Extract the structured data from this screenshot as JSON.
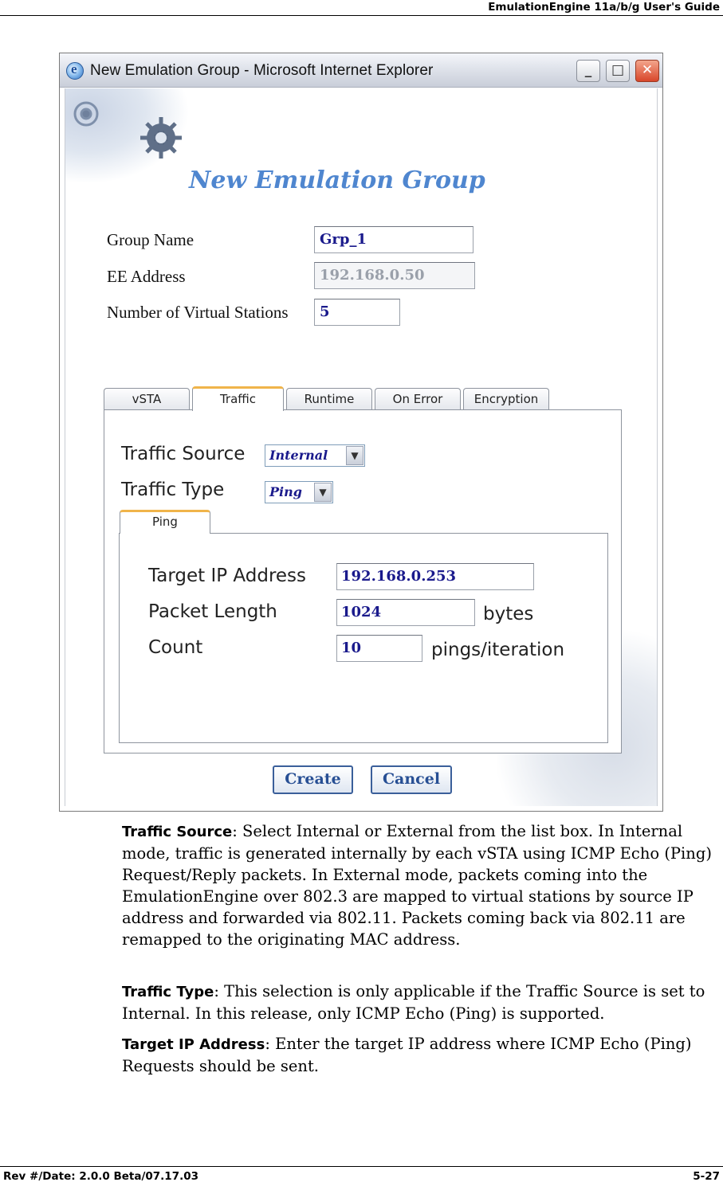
{
  "page_header": {
    "title": "EmulationEngine 11a/b/g User's Guide"
  },
  "page_footer": {
    "left": "Rev #/Date: 2.0.0 Beta/07.17.03",
    "right": "5-27"
  },
  "window": {
    "title": "New Emulation Group - Microsoft Internet Explorer",
    "buttons": {
      "minimize": "_",
      "maximize": "□",
      "close": "✕"
    }
  },
  "form": {
    "heading": "New Emulation Group",
    "group_name": {
      "label": "Group Name",
      "value": "Grp_1"
    },
    "ee_address": {
      "label": "EE Address",
      "value": "192.168.0.50"
    },
    "num_stations": {
      "label": "Number of Virtual Stations",
      "value": "5"
    }
  },
  "tabs": [
    {
      "label": "vSTA",
      "active": false
    },
    {
      "label": "Traffic",
      "active": true
    },
    {
      "label": "Runtime",
      "active": false
    },
    {
      "label": "On Error",
      "active": false
    },
    {
      "label": "Encryption",
      "active": false
    }
  ],
  "traffic": {
    "source": {
      "label": "Traffic Source",
      "value": "Internal"
    },
    "type": {
      "label": "Traffic Type",
      "value": "Ping"
    },
    "subtab": "Ping",
    "ping": {
      "target_ip": {
        "label": "Target IP Address",
        "value": "192.168.0.253"
      },
      "packet_length": {
        "label": "Packet Length",
        "value": "1024",
        "unit": "bytes"
      },
      "count": {
        "label": "Count",
        "value": "10",
        "unit": "pings/iteration"
      }
    }
  },
  "actions": {
    "create": "Create",
    "cancel": "Cancel"
  },
  "paragraphs": [
    {
      "term": "Traffic Source",
      "text": ": Select Internal or External from the list box. In Internal mode, traffic is generated internally by each vSTA using ICMP Echo (Ping) Request/Reply packets. In External mode, packets coming into the EmulationEngine over 802.3 are mapped to virtual stations by source IP address and forwarded via 802.11. Packets coming back via 802.11 are remapped to the originating MAC address."
    },
    {
      "term": "Traffic Type",
      "text": ": This selection is only applicable if the Traffic Source is set to Internal. In this release, only ICMP Echo (Ping) is supported."
    },
    {
      "term": "Target IP Address",
      "text": ": Enter the target IP address where ICMP Echo (Ping) Requests should be sent."
    }
  ],
  "colors": {
    "heading": "#4f86cf",
    "field_text": "#1a1a8c",
    "active_tab_accent": "#f0b44a"
  }
}
